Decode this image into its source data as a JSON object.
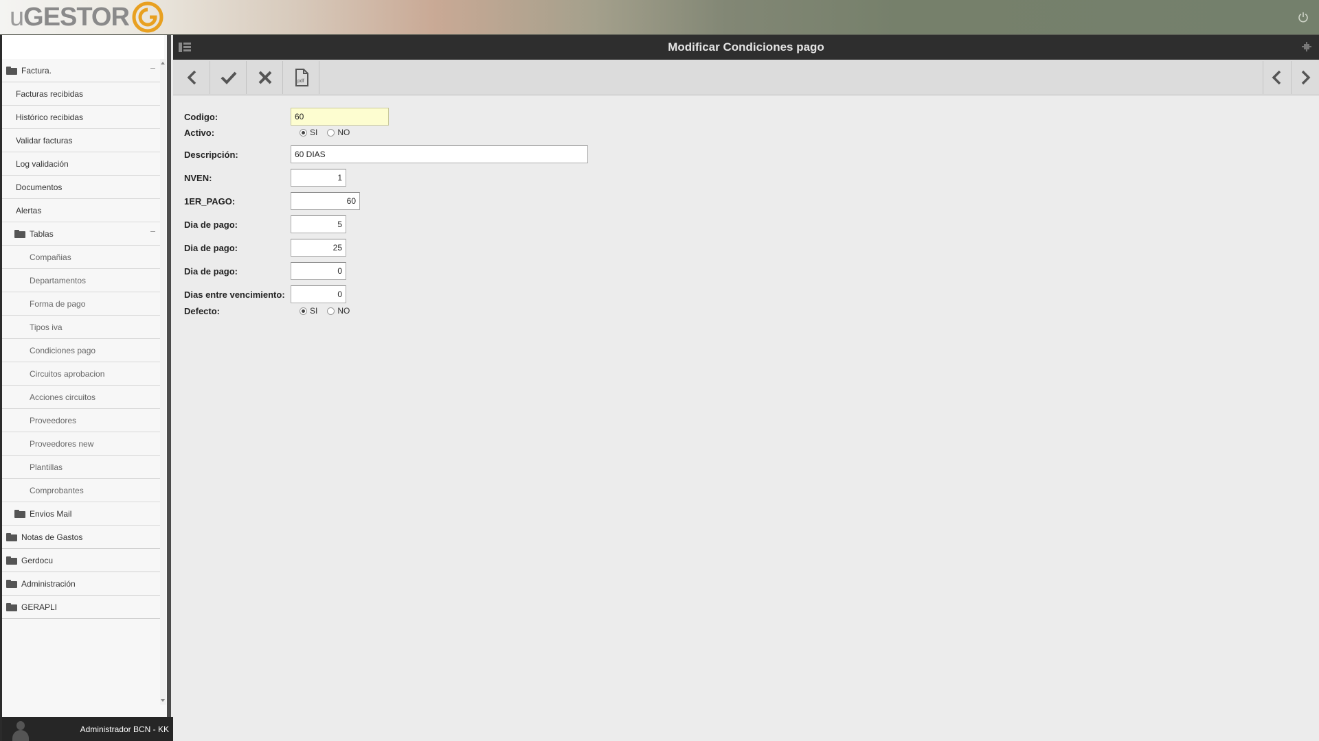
{
  "header": {
    "logo_prefix": "u",
    "logo_name": "GESTOR",
    "power_icon": "power-icon"
  },
  "title_bar": {
    "title": "Modificar Condiciones pago"
  },
  "toolbar": {
    "back_icon": "chevron-left-icon",
    "save_icon": "checkmark-icon",
    "cancel_icon": "close-icon",
    "pdf_icon": "pdf-document-icon",
    "pdf_text": "pdf",
    "prev_icon": "chevron-left-icon",
    "next_icon": "chevron-right-icon"
  },
  "sidebar": {
    "items": [
      {
        "label": "Factura.",
        "level": 0,
        "folder": true,
        "collapsible": true
      },
      {
        "label": "Facturas recibidas",
        "level": 1
      },
      {
        "label": "Histórico recibidas",
        "level": 1
      },
      {
        "label": "Validar facturas",
        "level": 1
      },
      {
        "label": "Log validación",
        "level": 1
      },
      {
        "label": "Documentos",
        "level": 1
      },
      {
        "label": "Alertas",
        "level": 1
      },
      {
        "label": "Tablas",
        "level": 1,
        "folder": true,
        "collapsible": true
      },
      {
        "label": "Compañias",
        "level": 2
      },
      {
        "label": "Departamentos",
        "level": 2
      },
      {
        "label": "Forma de pago",
        "level": 2
      },
      {
        "label": "Tipos iva",
        "level": 2
      },
      {
        "label": "Condiciones pago",
        "level": 2
      },
      {
        "label": "Circuitos aprobacion",
        "level": 2
      },
      {
        "label": "Acciones circuitos",
        "level": 2
      },
      {
        "label": "Proveedores",
        "level": 2
      },
      {
        "label": "Proveedores new",
        "level": 2
      },
      {
        "label": "Plantillas",
        "level": 2
      },
      {
        "label": "Comprobantes",
        "level": 2
      },
      {
        "label": "Envios Mail",
        "level": 1,
        "folder": true
      },
      {
        "label": "Notas de Gastos",
        "level": 0,
        "folder": true
      },
      {
        "label": "Gerdocu",
        "level": 0,
        "folder": true
      },
      {
        "label": "Administración",
        "level": 0,
        "folder": true
      },
      {
        "label": "GERAPLI",
        "level": 0,
        "folder": true
      }
    ]
  },
  "user": {
    "name": "Administrador BCN - KK"
  },
  "form": {
    "codigo": {
      "label": "Codigo:",
      "value": "60"
    },
    "activo": {
      "label": "Activo:",
      "yes": "SI",
      "no": "NO",
      "selected": "SI"
    },
    "descripcion": {
      "label": "Descripción:",
      "value": "60 DIAS"
    },
    "nven": {
      "label": "NVEN:",
      "value": "1"
    },
    "primer_pago": {
      "label": "1ER_PAGO:",
      "value": "60"
    },
    "dia_pago_1": {
      "label": "Dia de pago:",
      "value": "5"
    },
    "dia_pago_2": {
      "label": "Dia de pago:",
      "value": "25"
    },
    "dia_pago_3": {
      "label": "Dia de pago:",
      "value": "0"
    },
    "dias_entre": {
      "label": "Dias entre vencimiento:",
      "value": "0"
    },
    "defecto": {
      "label": "Defecto:",
      "yes": "SI",
      "no": "NO",
      "selected": "SI"
    }
  },
  "colors": {
    "accent": "#e8a020",
    "focus_field": "#fdfdd0",
    "title_bar": "#2e2e2e",
    "user_bar": "#262626"
  }
}
